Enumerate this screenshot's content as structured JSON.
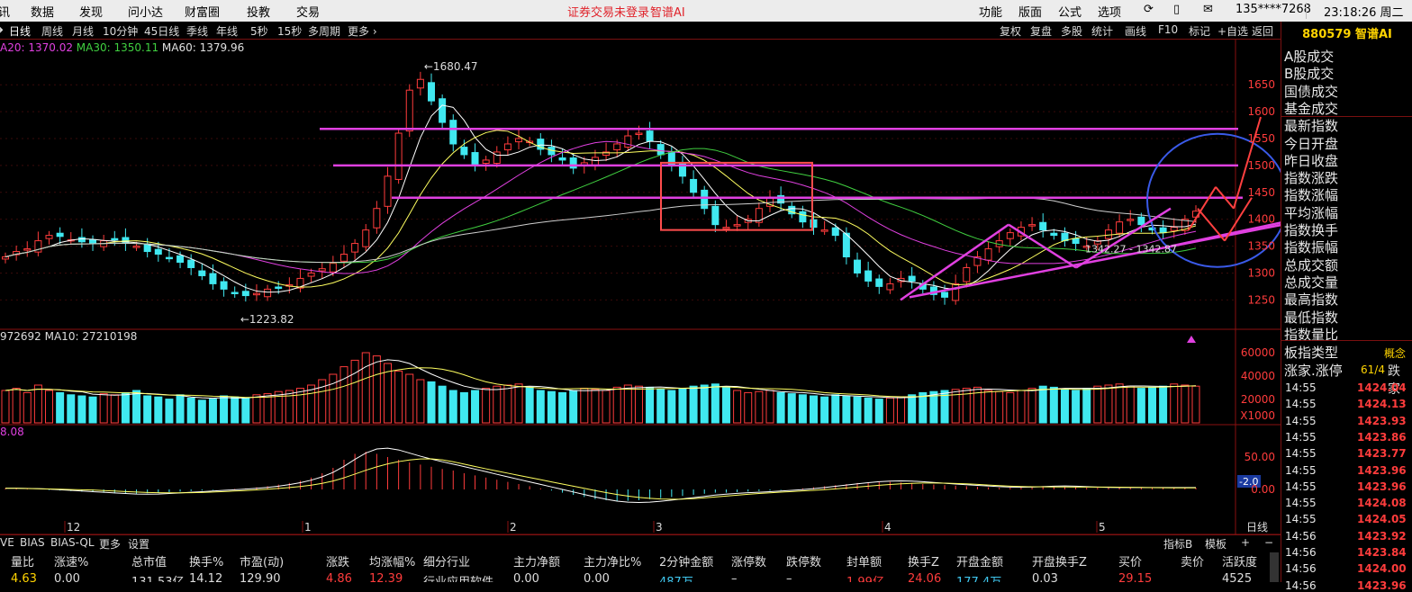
{
  "topbar": {
    "menu_left": [
      "讯",
      "数据",
      "发现",
      "问小达",
      "财富圈",
      "投教",
      "交易"
    ],
    "login_status": "证券交易未登录",
    "ai_label": "智谱AI",
    "menu_right": [
      "功能",
      "版面",
      "公式",
      "选项"
    ],
    "user": "135****7268",
    "clock": "23:18:26 周二"
  },
  "periods": [
    "日线",
    "周线",
    "月线",
    "10分钟",
    "45日线",
    "季线",
    "年线",
    "5秒",
    "15秒",
    "多周期",
    "更多"
  ],
  "selected_period": "日线",
  "toolbar_right": [
    "复权",
    "复盘",
    "多股",
    "统计",
    "画线",
    "F10",
    "标记",
    "+自选",
    "返回"
  ],
  "ma_legend": [
    {
      "text": "A20: 1370.02",
      "color": "#e040e0"
    },
    {
      "text": "MA30: 1350.11",
      "color": "#40d040"
    },
    {
      "text": "MA60: 1379.96",
      "color": "#e0e0e0"
    }
  ],
  "price_axis": [
    "1650",
    "1600",
    "1550",
    "1500",
    "1450",
    "1400",
    "1350",
    "1300",
    "1250"
  ],
  "price_annotations": {
    "high": "1680.47",
    "low": "1223.82",
    "mid": "1342.27 - 1342.87"
  },
  "volume_legend": "972692  MA10: 27210198",
  "volume_axis": [
    "60000",
    "40000",
    "20000",
    "X1000"
  ],
  "macd_legend": "8.08",
  "macd_axis": [
    "50.00",
    "-2.0",
    "0.00"
  ],
  "date_axis": [
    "12",
    "1",
    "2",
    "3",
    "4",
    "5",
    "日线"
  ],
  "indicator_tabs": [
    "VE",
    "BIAS",
    "BIAS-QL",
    "更多",
    "设置"
  ],
  "indicator_right": [
    "指标B",
    "模板",
    "+",
    "−"
  ],
  "table": {
    "headers": [
      "量比",
      "涨速%",
      "总市值",
      "换手%",
      "市盈(动)",
      "涨跌",
      "均涨幅%",
      "细分行业",
      "主力净额",
      "主力净比%",
      "2分钟金额",
      "涨停数",
      "跌停数",
      "封单额",
      "换手Z",
      "开盘金额",
      "开盘换手Z",
      "买价",
      "卖价",
      "活跃度"
    ],
    "row": [
      "4.63",
      "0.00",
      "131.53亿",
      "14.12",
      "129.90",
      "4.86",
      "12.39",
      "行业应用软件",
      "0.00",
      "0.00",
      "487万",
      "–",
      "–",
      "1.99亿",
      "24.06",
      "177.4万",
      "0.03",
      "29.15",
      "",
      "4525"
    ]
  },
  "right_panel": {
    "title": "880579 智谱AI",
    "labels": [
      "A股成交",
      "B股成交",
      "国债成交",
      "基金成交",
      "最新指数",
      "今日开盘",
      "昨日收盘",
      "指数涨跌",
      "指数涨幅",
      "平均涨幅",
      "指数换手",
      "指数振幅",
      "总成交额",
      "总成交量",
      "最高指数",
      "最低指数",
      "指数量比"
    ],
    "type_label": "板指类型",
    "type_value": "概念",
    "updown_label": "涨家.涨停",
    "updown_value": "61/4",
    "updown_right": "跌家",
    "ticks": [
      {
        "time": "14:55",
        "price": "1424.04"
      },
      {
        "time": "14:55",
        "price": "1424.13"
      },
      {
        "time": "14:55",
        "price": "1423.93"
      },
      {
        "time": "14:55",
        "price": "1423.86"
      },
      {
        "time": "14:55",
        "price": "1423.77"
      },
      {
        "time": "14:55",
        "price": "1423.96"
      },
      {
        "time": "14:55",
        "price": "1423.96"
      },
      {
        "time": "14:55",
        "price": "1424.08"
      },
      {
        "time": "14:55",
        "price": "1424.05"
      },
      {
        "time": "14:56",
        "price": "1423.92"
      },
      {
        "time": "14:56",
        "price": "1423.84"
      },
      {
        "time": "14:56",
        "price": "1424.00"
      },
      {
        "time": "14:56",
        "price": "1423.96"
      }
    ]
  },
  "colors": {
    "up": "#ff3c3c",
    "down": "#40e8f0",
    "accent": "#e040e0",
    "axis": "#a01010"
  },
  "chart_data": {
    "type": "candlestick",
    "y_range": [
      1223.82,
      1680.47
    ],
    "closes": [
      1330,
      1340,
      1345,
      1360,
      1370,
      1368,
      1362,
      1358,
      1355,
      1360,
      1362,
      1355,
      1350,
      1340,
      1335,
      1328,
      1320,
      1310,
      1295,
      1280,
      1270,
      1262,
      1258,
      1262,
      1270,
      1272,
      1278,
      1290,
      1300,
      1308,
      1318,
      1335,
      1355,
      1380,
      1420,
      1480,
      1560,
      1640,
      1660,
      1620,
      1580,
      1540,
      1520,
      1500,
      1510,
      1525,
      1540,
      1550,
      1545,
      1530,
      1520,
      1510,
      1495,
      1505,
      1515,
      1525,
      1540,
      1555,
      1560,
      1545,
      1520,
      1500,
      1480,
      1450,
      1420,
      1390,
      1385,
      1390,
      1400,
      1420,
      1440,
      1430,
      1410,
      1395,
      1385,
      1380,
      1370,
      1330,
      1300,
      1285,
      1275,
      1280,
      1290,
      1285,
      1270,
      1260,
      1255,
      1280,
      1310,
      1330,
      1345,
      1360,
      1375,
      1385,
      1390,
      1380,
      1370,
      1360,
      1355,
      1350,
      1360,
      1380,
      1395,
      1400,
      1390,
      1380,
      1375,
      1385,
      1400,
      1415
    ],
    "volumes": [
      30,
      32,
      28,
      35,
      30,
      28,
      26,
      25,
      24,
      27,
      26,
      28,
      30,
      25,
      24,
      22,
      26,
      23,
      21,
      22,
      25,
      24,
      23,
      26,
      27,
      29,
      30,
      32,
      35,
      40,
      45,
      52,
      58,
      65,
      62,
      55,
      48,
      45,
      40,
      38,
      34,
      30,
      28,
      30,
      32,
      34,
      35,
      36,
      33,
      30,
      29,
      28,
      30,
      32,
      31,
      30,
      33,
      35,
      34,
      33,
      31,
      30,
      32,
      34,
      35,
      36,
      33,
      30,
      28,
      29,
      30,
      28,
      27,
      26,
      25,
      24,
      26,
      25,
      24,
      23,
      22,
      23,
      24,
      26,
      28,
      29,
      30,
      31,
      32,
      33,
      30,
      29,
      28,
      30,
      32,
      34,
      33,
      31,
      30,
      32,
      34,
      35,
      36,
      34,
      32,
      33,
      34,
      36,
      35,
      34
    ],
    "macd": [
      2,
      2,
      1,
      0,
      -1,
      -2,
      -3,
      -4,
      -5,
      -6,
      -7,
      -8,
      -8,
      -7,
      -6,
      -5,
      -4,
      -3,
      -2,
      -1,
      0,
      1,
      2,
      4,
      6,
      9,
      12,
      16,
      22,
      30,
      40,
      55,
      66,
      70,
      66,
      60,
      55,
      50,
      46,
      42,
      38,
      35,
      30,
      26,
      22,
      18,
      14,
      10,
      6,
      2,
      -2,
      -6,
      -10,
      -14,
      -18,
      -20,
      -22,
      -21,
      -20,
      -18,
      -16,
      -14,
      -12,
      -10,
      -8,
      -6,
      -6,
      -5,
      -4,
      -3,
      -2,
      -1,
      0,
      2,
      4,
      6,
      8,
      10,
      12,
      13,
      14,
      14,
      13,
      12,
      10,
      9,
      8,
      7,
      6,
      5,
      4,
      3,
      3,
      4,
      5,
      6,
      6,
      5,
      4,
      3,
      3,
      3,
      3,
      3,
      3,
      3,
      3,
      3,
      3,
      3
    ]
  }
}
